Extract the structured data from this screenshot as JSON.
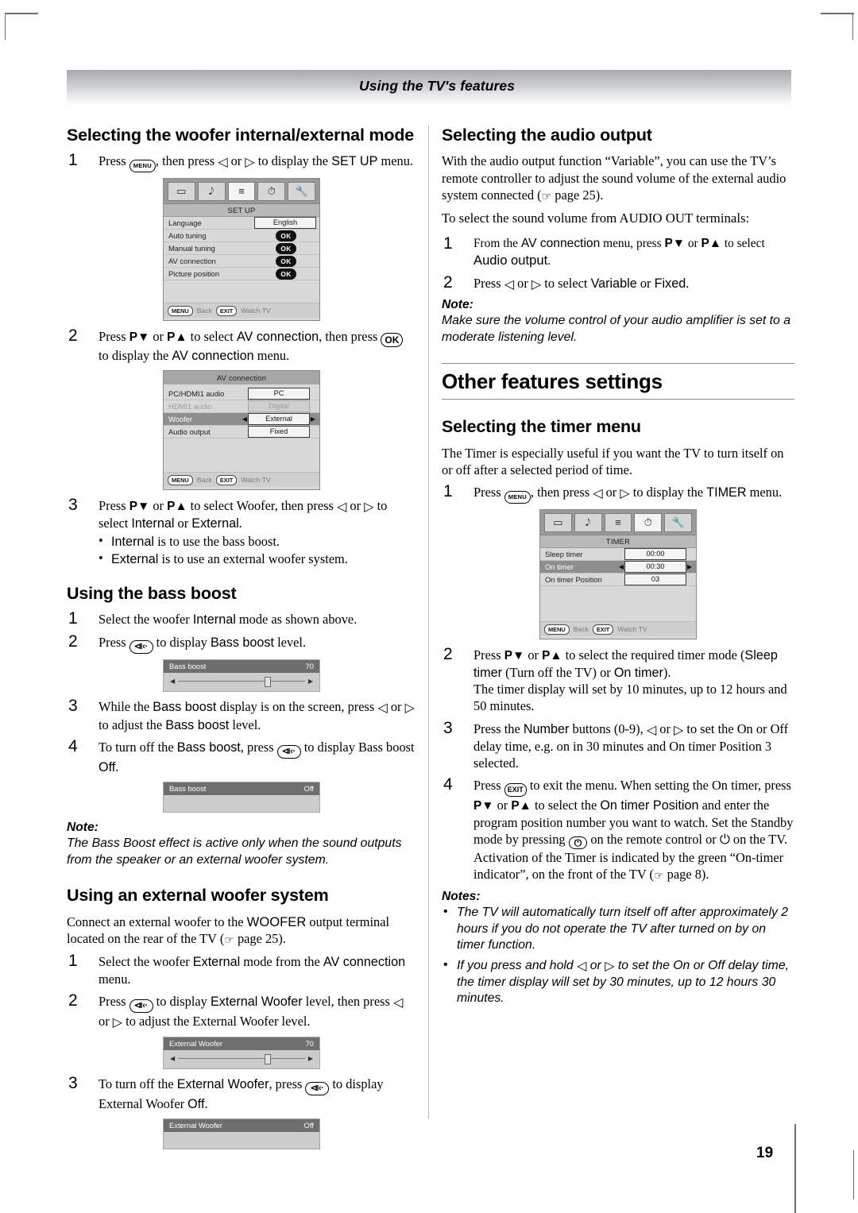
{
  "header": {
    "running_title": "Using the TV's features"
  },
  "page_number": "19",
  "left_column": {
    "section1": {
      "heading": "Selecting the woofer internal/external mode",
      "step1": {
        "num": "1",
        "text_a": "Press ",
        "key_menu": "MENU",
        "text_b": ", then press ",
        "arrow_left": "◁",
        "text_c": " or ",
        "arrow_right": "▷",
        "text_d": " to display the ",
        "ui": "SET UP",
        "text_e": " menu."
      },
      "setup_menu": {
        "title": "SET UP",
        "rows": [
          {
            "label": "Language",
            "value": "English",
            "type": "value"
          },
          {
            "label": "Auto tuning",
            "value": "OK",
            "type": "ok"
          },
          {
            "label": "Manual tuning",
            "value": "OK",
            "type": "ok"
          },
          {
            "label": "AV connection",
            "value": "OK",
            "type": "ok"
          },
          {
            "label": "Picture position",
            "value": "OK",
            "type": "ok"
          }
        ],
        "footer": {
          "menu_key": "MENU",
          "menu_label": "Back",
          "exit_key": "EXIT",
          "exit_label": "Watch TV"
        }
      },
      "step2": {
        "num": "2",
        "text_a": "Press ",
        "pdown": "P▼",
        "text_b": " or ",
        "pup": "P▲",
        "text_c": " to select ",
        "ui1": "AV connection",
        "text_d": ", then press ",
        "key_ok": "OK",
        "text_e": " to display the ",
        "ui2": "AV connection",
        "text_f": " menu."
      },
      "av_menu": {
        "title": "AV connection",
        "rows": [
          {
            "label": "PC/HDMI1 audio",
            "value": "PC",
            "state": "normal"
          },
          {
            "label": "HDMI1 audio",
            "value": "Digital",
            "state": "dim"
          },
          {
            "label": "Woofer",
            "value": "External",
            "state": "selected"
          },
          {
            "label": "Audio output",
            "value": "Fixed",
            "state": "normal"
          }
        ],
        "footer": {
          "menu_key": "MENU",
          "menu_label": "Back",
          "exit_key": "EXIT",
          "exit_label": "Watch TV"
        }
      },
      "step3": {
        "num": "3",
        "text_a": "Press ",
        "pdown": "P▼",
        "text_b": " or ",
        "pup": "P▲",
        "text_c": " to select Woofer, then press ",
        "arrow_left": "◁",
        "text_d": " or ",
        "arrow_right": "▷",
        "text_e": " to select ",
        "ui1": "Internal",
        "text_f": " or ",
        "ui2": "External",
        "text_g": "."
      },
      "step3_bullets": [
        {
          "ui": "Internal",
          "text": " is to use the bass boost."
        },
        {
          "ui": "External",
          "text": " is to use an external woofer system."
        }
      ]
    },
    "section2": {
      "heading": "Using the bass boost",
      "step1": {
        "num": "1",
        "text_a": "Select the woofer ",
        "ui": "Internal",
        "text_b": " mode as shown above."
      },
      "step2": {
        "num": "2",
        "text_a": "Press ",
        "key_speaker": "⧏‹·",
        "text_b": " to display ",
        "ui": "Bass boost",
        "text_c": " level."
      },
      "level_on": {
        "label": "Bass boost",
        "value": "70"
      },
      "step3": {
        "num": "3",
        "text_a": "While the ",
        "ui1": "Bass boost",
        "text_b": " display is on the screen, press ",
        "arrow_left": "◁",
        "text_c": " or ",
        "arrow_right": "▷",
        "text_d": " to adjust the ",
        "ui2": "Bass boost",
        "text_e": " level."
      },
      "step4": {
        "num": "4",
        "text_a": "To turn off the ",
        "ui1": "Bass boost",
        "text_b": ", press ",
        "key_speaker": "⧏‹·",
        "text_c": " to display Bass boost ",
        "ui2": "Off",
        "text_d": "."
      },
      "level_off": {
        "label": "Bass boost",
        "value": "Off"
      },
      "note_title": "Note:",
      "note_body": "The Bass Boost effect is active only when the sound outputs from the speaker or an external woofer system."
    },
    "section3": {
      "heading": "Using an external woofer system",
      "intro_a": "Connect an external woofer to the ",
      "intro_ui": "WOOFER",
      "intro_b": " output terminal located on the rear of the TV (",
      "intro_ref": "page 25",
      "intro_c": ").",
      "step1": {
        "num": "1",
        "text_a": "Select the woofer ",
        "ui1": "External",
        "text_b": " mode from the ",
        "ui2": "AV connection",
        "text_c": " menu."
      },
      "step2": {
        "num": "2",
        "text_a": "Press ",
        "key_speaker": "⧏‹·",
        "text_b": " to display ",
        "ui": "External Woofer",
        "text_c": " level, then press ",
        "arrow_left": "◁",
        "text_d": " or ",
        "arrow_right": "▷",
        "text_e": " to adjust the External Woofer level."
      },
      "level_on": {
        "label": "External Woofer",
        "value": "70"
      },
      "step3": {
        "num": "3",
        "text_a": "To turn off the ",
        "ui1": "External Woofer",
        "text_b": ", press ",
        "key_speaker": "⧏‹·",
        "text_c": " to display External Woofer ",
        "ui2": "Off",
        "text_d": "."
      },
      "level_off": {
        "label": "External Woofer",
        "value": "Off"
      }
    }
  },
  "right_column": {
    "section1": {
      "heading": "Selecting the audio output",
      "intro_a": "With the audio output function “Variable”, you can use the TV’s remote controller to adjust the sound volume of the external audio system connected (",
      "intro_ref": "page 25",
      "intro_b": ").",
      "subhead": "To select the sound volume from AUDIO OUT terminals:",
      "step1": {
        "num": "1",
        "text_a": "From the ",
        "ui1": "AV connection",
        "text_b": " menu, press ",
        "pdown": "P▼",
        "text_c": " or ",
        "pup": "P▲",
        "text_d": " to select ",
        "ui2": "Audio output",
        "text_e": "."
      },
      "step2": {
        "num": "2",
        "text_a": "Press ",
        "arrow_left": "◁",
        "text_b": " or ",
        "arrow_right": "▷",
        "text_c": " to select ",
        "ui1": "Variable",
        "text_d": " or ",
        "ui2": "Fixed",
        "text_e": "."
      },
      "note_title": "Note:",
      "note_body": "Make sure the volume control of your audio amplifier is set to a moderate listening level."
    },
    "big_heading": "Other features settings",
    "section2": {
      "heading": "Selecting the timer menu",
      "intro": "The Timer is especially useful if you want the TV to turn itself on or off after a selected period of time.",
      "step1": {
        "num": "1",
        "text_a": "Press ",
        "key_menu": "MENU",
        "text_b": ", then press ",
        "arrow_left": "◁",
        "text_c": " or ",
        "arrow_right": "▷",
        "text_d": " to display the ",
        "ui": "TIMER",
        "text_e": " menu."
      },
      "timer_menu": {
        "title": "TIMER",
        "rows": [
          {
            "label": "Sleep timer",
            "value": "00:00",
            "state": "normal"
          },
          {
            "label": "On timer",
            "value": "00:30",
            "state": "selected"
          },
          {
            "label": "On timer Position",
            "value": "03",
            "state": "normal"
          }
        ],
        "footer": {
          "menu_key": "MENU",
          "menu_label": "Back",
          "exit_key": "EXIT",
          "exit_label": "Watch TV"
        }
      },
      "step2": {
        "num": "2",
        "text_a": "Press ",
        "pdown": "P▼",
        "text_b": " or ",
        "pup": "P▲",
        "text_c": " to select the required timer mode (",
        "ui1": "Sleep timer",
        "text_d": " (Turn off the TV) or ",
        "ui2": "On timer",
        "text_e": ").",
        "text_f": "The timer display will set by 10 minutes, up to 12 hours and 50 minutes."
      },
      "step3": {
        "num": "3",
        "text_a": "Press the ",
        "ui1": "Number",
        "text_b": " buttons (0-9), ",
        "arrow_left": "◁",
        "text_c": " or ",
        "arrow_right": "▷",
        "text_d": " to set the On or Off delay time,  e.g. on in 30 minutes and On timer Position 3 selected."
      },
      "step4": {
        "num": "4",
        "text_a": "Press ",
        "key_exit": "EXIT",
        "text_b": " to exit the menu. When setting the On timer, press ",
        "pdown": "P▼",
        "text_c": " or ",
        "pup": "P▲",
        "text_d": " to select the ",
        "ui1": "On timer Position",
        "text_e": " and enter the program position number you want to watch. Set the Standby mode by pressing ",
        "key_power": "⏻",
        "text_f": " on the remote control or ",
        "glyph_power": "⏻",
        "text_g": " on the TV.",
        "text_h": "Activation of the Timer is indicated by the green “On-timer indicator”, on the front of the TV (",
        "ref": "page 8",
        "text_i": ")."
      },
      "notes_title": "Notes:",
      "notes": [
        {
          "text": "The TV will automatically turn itself off after approximately 2 hours if you do not operate the TV after turned on by on timer function."
        },
        {
          "text_a": "If you press and hold ",
          "arrow_left": "◁",
          "text_b": " or ",
          "arrow_right": "▷",
          "text_c": " to set the On or Off delay time, the timer display will set by 30 minutes, up to 12 hours 30 minutes."
        }
      ]
    }
  },
  "icons": {
    "menu_icons": [
      "picture-icon",
      "sound-icon",
      "setup-icon",
      "timer-icon",
      "options-icon"
    ]
  }
}
